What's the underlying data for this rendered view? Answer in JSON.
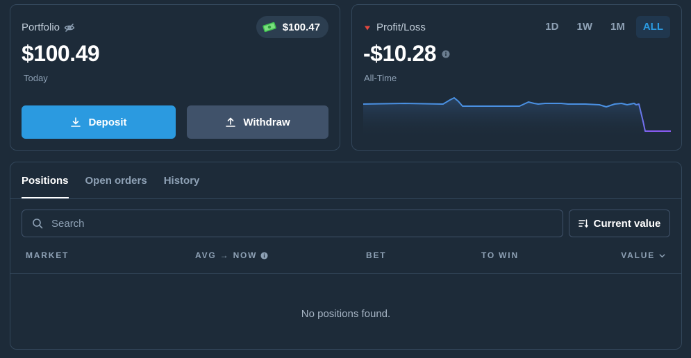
{
  "portfolio": {
    "title": "Portfolio",
    "cash": "$100.47",
    "value": "$100.49",
    "period": "Today",
    "deposit_label": "Deposit",
    "withdraw_label": "Withdraw"
  },
  "pnl": {
    "title": "Profit/Loss",
    "value": "-$10.28",
    "period": "All-Time",
    "ranges": [
      "1D",
      "1W",
      "1M",
      "ALL"
    ],
    "active_range": "ALL"
  },
  "positions": {
    "tabs": [
      "Positions",
      "Open orders",
      "History"
    ],
    "active_tab": "Positions",
    "search_placeholder": "Search",
    "sort_label": "Current value",
    "columns": {
      "market": "MARKET",
      "avg_now": "AVG → NOW",
      "bet": "BET",
      "to_win": "TO WIN",
      "value": "VALUE"
    },
    "empty_message": "No positions found."
  },
  "colors": {
    "accent": "#2b9ae0",
    "loss": "#e5483f",
    "line": "#4a90e2",
    "line_end": "#8a5cf5"
  }
}
